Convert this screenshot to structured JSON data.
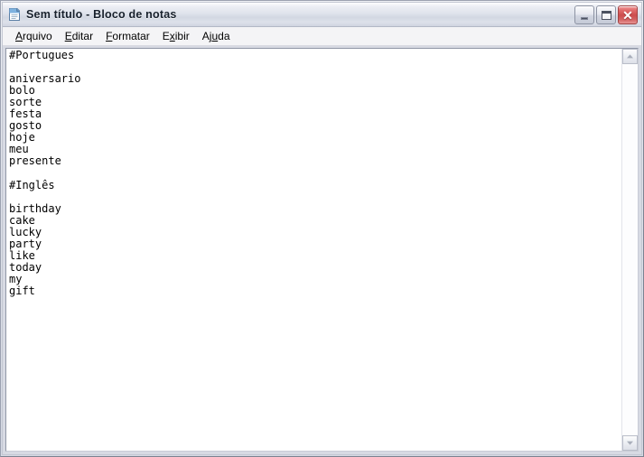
{
  "window": {
    "title": "Sem título - Bloco de notas",
    "icon": "notepad-icon",
    "controls": {
      "minimize_label": "Minimizar",
      "maximize_label": "Maximizar",
      "close_label": "Fechar",
      "close_glyph": "✕",
      "close_color": "#cc4d4d"
    }
  },
  "menu": {
    "items": [
      {
        "label": "Arquivo",
        "accel_index": 0
      },
      {
        "label": "Editar",
        "accel_index": 0
      },
      {
        "label": "Formatar",
        "accel_index": 0
      },
      {
        "label": "Exibir",
        "accel_index": 1
      },
      {
        "label": "Ajuda",
        "accel_index": 2
      }
    ]
  },
  "editor": {
    "text": "#Portugues\n\naniversario\nbolo\nsorte\nfesta\ngosto\nhoje\nmeu\npresente\n\n#Inglês\n\nbirthday\ncake\nlucky\nparty\nlike\ntoday\nmy\ngift",
    "sections": [
      {
        "heading": "#Portugues",
        "words": [
          "aniversario",
          "bolo",
          "sorte",
          "festa",
          "gosto",
          "hoje",
          "meu",
          "presente"
        ]
      },
      {
        "heading": "#Inglês",
        "words": [
          "birthday",
          "cake",
          "lucky",
          "party",
          "like",
          "today",
          "my",
          "gift"
        ]
      }
    ]
  },
  "scrollbar": {
    "up_arrow": "chevron-up-icon",
    "down_arrow": "chevron-down-icon",
    "thumb_visible": false
  }
}
